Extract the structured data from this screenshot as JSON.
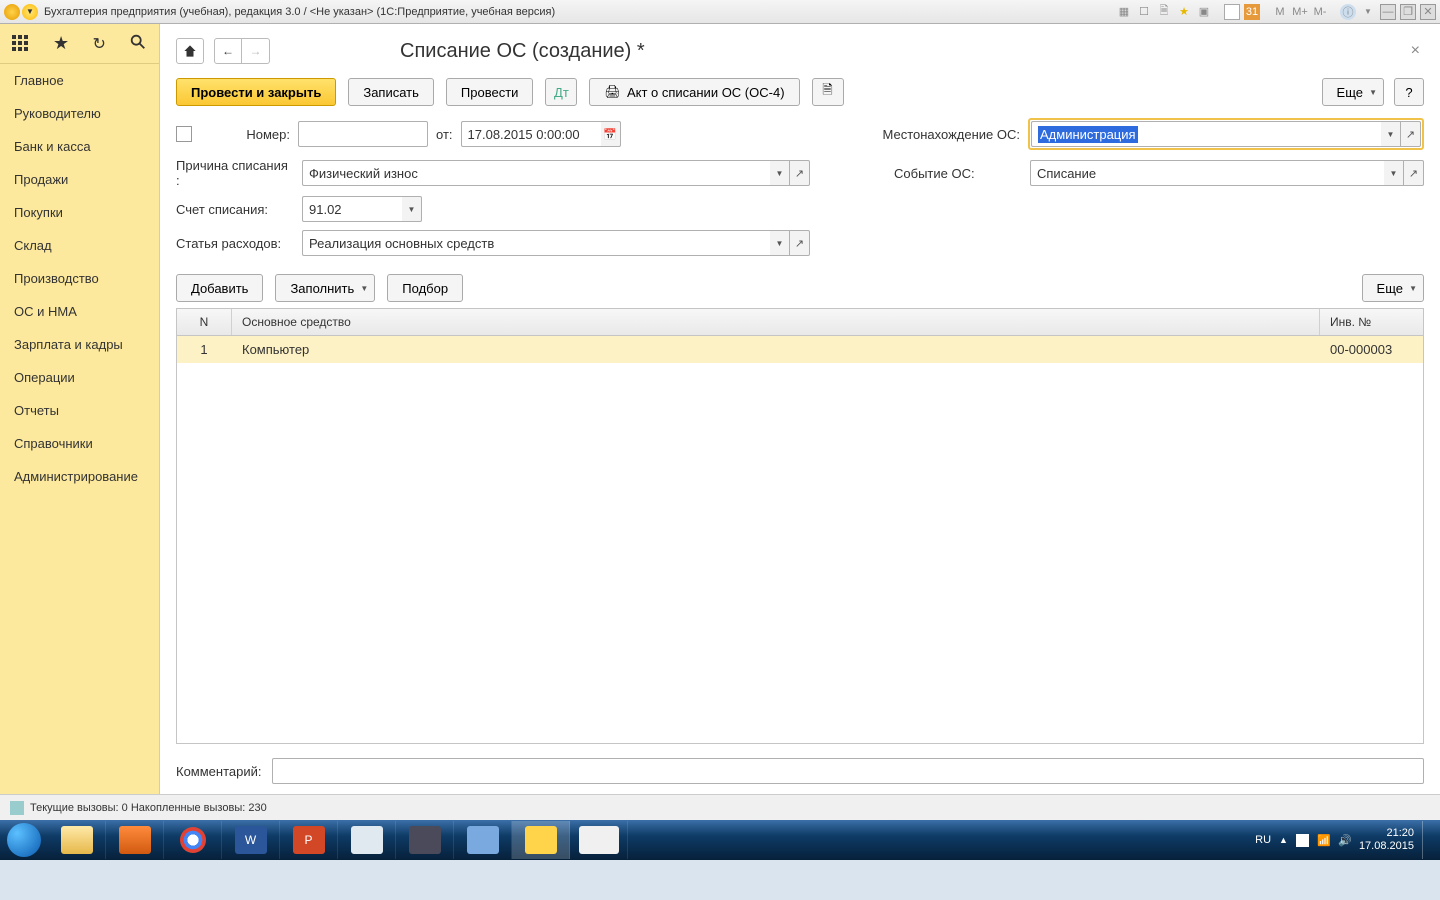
{
  "titlebar": {
    "text": "Бухгалтерия предприятия (учебная), редакция 3.0 / <Не указан>  (1С:Предприятие, учебная версия)",
    "m_labels": [
      "M",
      "M+",
      "M-"
    ]
  },
  "sidebar": {
    "items": [
      "Главное",
      "Руководителю",
      "Банк и касса",
      "Продажи",
      "Покупки",
      "Склад",
      "Производство",
      "ОС и НМА",
      "Зарплата и кадры",
      "Операции",
      "Отчеты",
      "Справочники",
      "Администрирование"
    ]
  },
  "page": {
    "title": "Списание ОС (создание) *"
  },
  "toolbar": {
    "post_close": "Провести и закрыть",
    "record": "Записать",
    "post": "Провести",
    "act": "Акт о списании ОС (ОС-4)",
    "more": "Еще",
    "help": "?"
  },
  "form": {
    "number_label": "Номер:",
    "number_value": "",
    "from_label": "от:",
    "date_value": "17.08.2015  0:00:00",
    "location_label": "Местонахождение ОС:",
    "location_value": "Администрация",
    "reason_label": "Причина списания :",
    "reason_value": "Физический износ",
    "event_label": "Событие ОС:",
    "event_value": "Списание",
    "account_label": "Счет списания:",
    "account_value": "91.02",
    "expense_label": "Статья расходов:",
    "expense_value": "Реализация основных средств"
  },
  "subtoolbar": {
    "add": "Добавить",
    "fill": "Заполнить",
    "select": "Подбор",
    "more": "Еще"
  },
  "table": {
    "headers": {
      "n": "N",
      "name": "Основное средство",
      "inv": "Инв. №"
    },
    "rows": [
      {
        "n": "1",
        "name": "Компьютер",
        "inv": "00-000003"
      }
    ]
  },
  "comment": {
    "label": "Комментарий:",
    "value": ""
  },
  "statusbar": {
    "text": "Текущие вызовы: 0  Накопленные вызовы: 230"
  },
  "taskbar": {
    "lang": "RU",
    "time": "21:20",
    "date": "17.08.2015"
  }
}
